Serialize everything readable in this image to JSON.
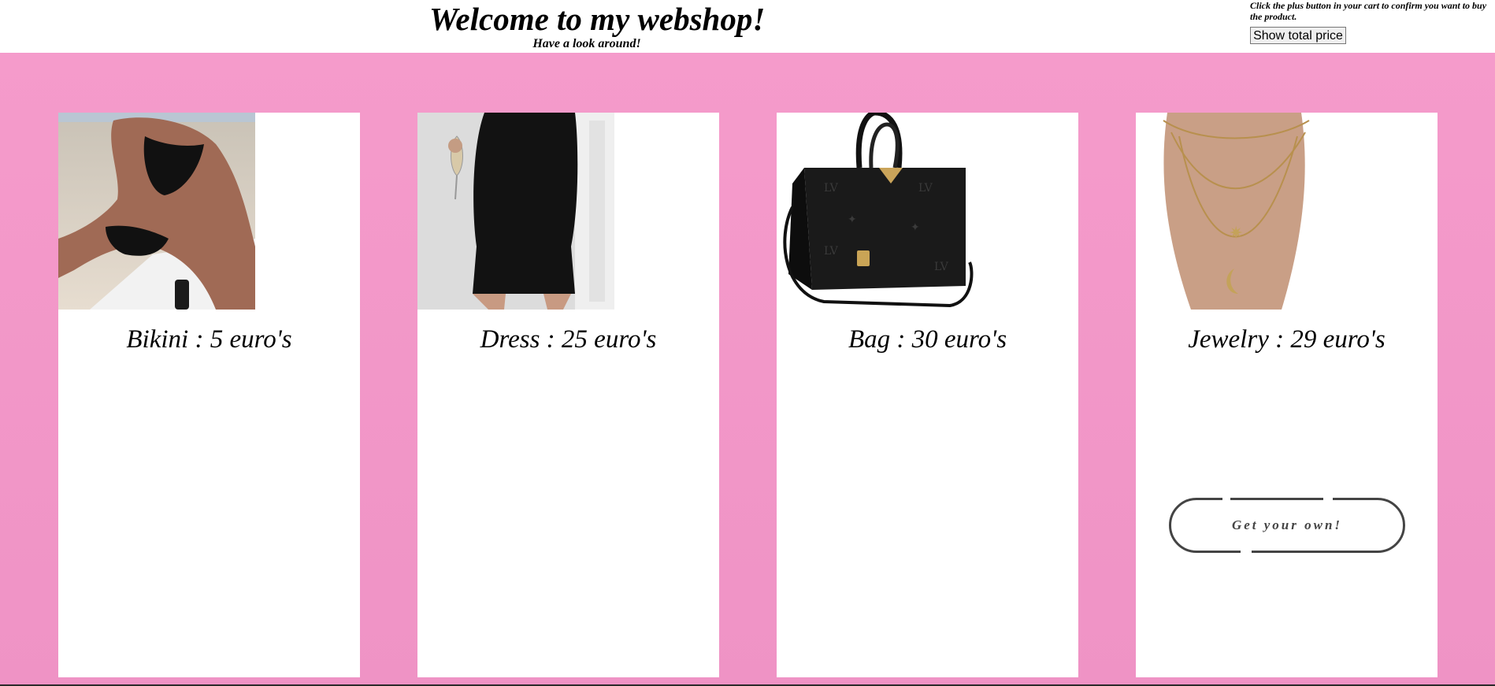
{
  "header": {
    "title": "Welcome to my webshop!",
    "subtitle": "Have a look around!",
    "note": "Click the plus button in your cart to confirm you want to buy the product.",
    "total_button": "Show total price"
  },
  "products": [
    {
      "label": "Bikini : 5 euro's",
      "image": "bikini-photo"
    },
    {
      "label": "Dress : 25 euro's",
      "image": "dress-photo"
    },
    {
      "label": "Bag : 30 euro's",
      "image": "bag-photo"
    },
    {
      "label": "Jewelry : 29 euro's",
      "image": "jewelry-photo"
    }
  ],
  "cta": {
    "label": "Get your own!"
  },
  "colors": {
    "background_pink": "#f495c8",
    "card": "#ffffff",
    "button_border": "#444444"
  }
}
